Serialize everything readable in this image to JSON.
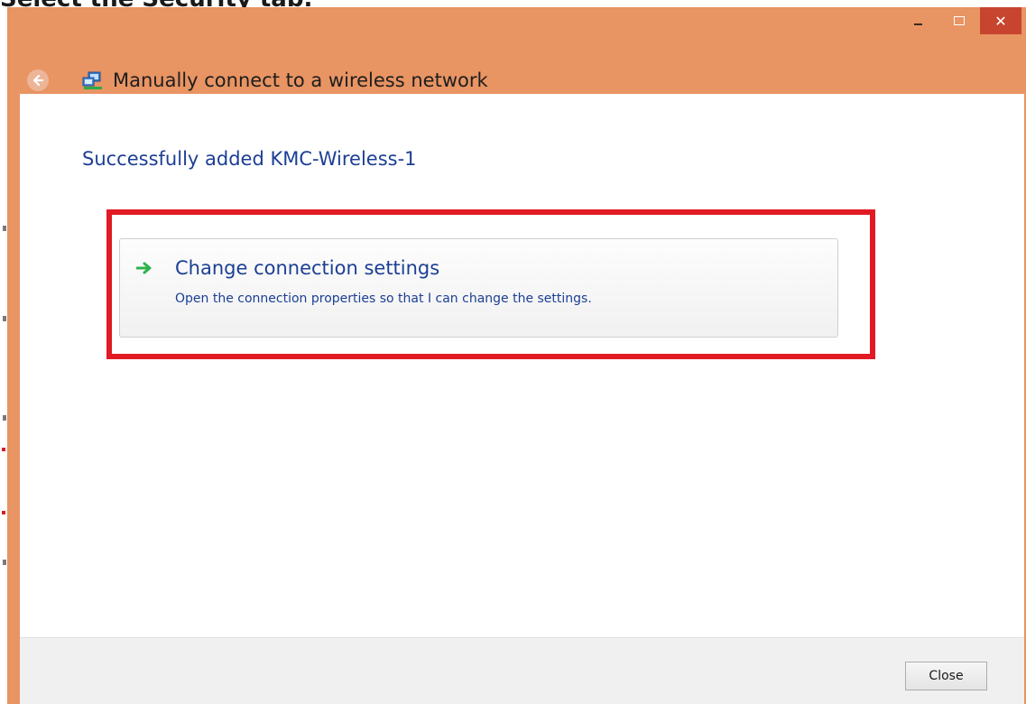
{
  "background": {
    "text": "Select the Security tab."
  },
  "window": {
    "title": "Manually connect to a wireless network",
    "caption": {
      "close_glyph": "✕"
    }
  },
  "main": {
    "success_message": "Successfully added KMC-Wireless-1",
    "command_link": {
      "title": "Change connection settings",
      "description": "Open the connection properties so that I can change the settings."
    }
  },
  "footer": {
    "close_label": "Close"
  },
  "colors": {
    "titlebar": "#E89463",
    "close_button": "#C7452E",
    "link_text": "#1c3f94",
    "highlight_border": "#E11A24",
    "arrow": "#2DB34A"
  }
}
